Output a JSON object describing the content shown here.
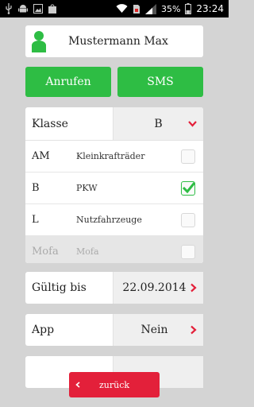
{
  "statusbar": {
    "battery_percent": "35%",
    "time": "23:24"
  },
  "contact": {
    "name": "Mustermann Max",
    "icon": "person-icon"
  },
  "actions": {
    "call_label": "Anrufen",
    "sms_label": "SMS"
  },
  "license_class": {
    "label": "Klasse",
    "selected": "B",
    "options": [
      {
        "code": "AM",
        "description": "Kleinkrafträder",
        "checked": false
      },
      {
        "code": "B",
        "description": "PKW",
        "checked": true
      },
      {
        "code": "L",
        "description": "Nutzfahrzeuge",
        "checked": false
      },
      {
        "code": "Mofa",
        "description": "Mofa",
        "checked": false
      }
    ]
  },
  "valid_until": {
    "label": "Gültig bis",
    "value": "22.09.2014"
  },
  "app": {
    "label": "App",
    "value": "Nein"
  },
  "back_button": {
    "label": "zurück"
  },
  "colors": {
    "accent_green": "#2ebd44",
    "accent_red": "#e3203a",
    "background": "#d4d4d4"
  }
}
